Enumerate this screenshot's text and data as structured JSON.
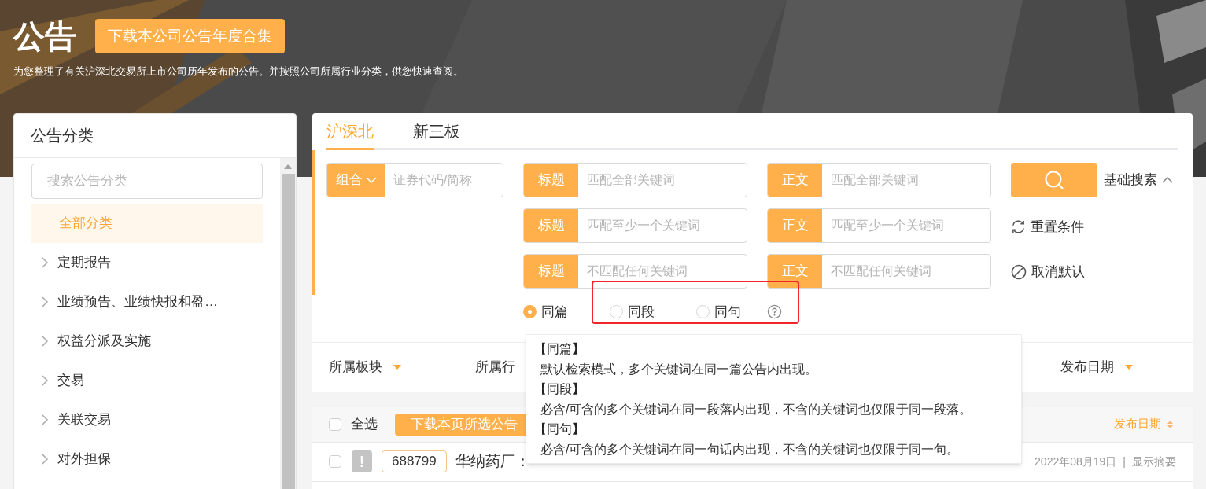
{
  "header": {
    "title": "公告",
    "download_button": "下载本公司公告年度合集",
    "description": "为您整理了有关沪深北交易所上市公司历年发布的公告。并按照公司所属行业分类，供您快速查阅。"
  },
  "sidebar": {
    "title": "公告分类",
    "search": {
      "placeholder": "搜索公告分类"
    },
    "items": [
      {
        "label": "全部分类",
        "selected": true,
        "expandable": false
      },
      {
        "label": "定期报告",
        "selected": false,
        "expandable": true
      },
      {
        "label": "业绩预告、业绩快报和盈…",
        "selected": false,
        "expandable": true
      },
      {
        "label": "权益分派及实施",
        "selected": false,
        "expandable": true
      },
      {
        "label": "交易",
        "selected": false,
        "expandable": true
      },
      {
        "label": "关联交易",
        "selected": false,
        "expandable": true
      },
      {
        "label": "对外担保",
        "selected": false,
        "expandable": true
      }
    ]
  },
  "tabs": [
    {
      "label": "沪深北",
      "selected": true
    },
    {
      "label": "新三板",
      "selected": false
    }
  ],
  "search": {
    "combo": {
      "label": "组合",
      "placeholder": "证券代码/简称"
    },
    "title_fields": [
      {
        "tag": "标题",
        "placeholder": "匹配全部关键词"
      },
      {
        "tag": "标题",
        "placeholder": "匹配至少一个关键词"
      },
      {
        "tag": "标题",
        "placeholder": "不匹配任何关键词"
      }
    ],
    "body_fields": [
      {
        "tag": "正文",
        "placeholder": "匹配全部关键词"
      },
      {
        "tag": "正文",
        "placeholder": "匹配至少一个关键词"
      },
      {
        "tag": "正文",
        "placeholder": "不匹配任何关键词"
      }
    ],
    "mode_toggle": "基础搜索",
    "reset": "重置条件",
    "cancel_default": "取消默认",
    "match_modes": [
      {
        "label": "同篇",
        "selected": true
      },
      {
        "label": "同段",
        "selected": false
      },
      {
        "label": "同句",
        "selected": false
      }
    ]
  },
  "filters": [
    {
      "label": "所属板块",
      "kind": "dropdown"
    },
    {
      "label": "所属行",
      "kind": "covered"
    },
    {
      "label": "发布日期",
      "kind": "dropdown"
    }
  ],
  "list": {
    "select_all": {
      "label": "全选",
      "checked": false
    },
    "download_button": "下载本页所选公告",
    "sort_label": "发布日期",
    "rows": [
      {
        "checked": false,
        "flag": "!",
        "code": "688799",
        "title": "华纳药厂：",
        "date": "2022年08月19日",
        "separator": "|",
        "action": "显示摘要"
      }
    ]
  },
  "tooltip": {
    "lines": [
      {
        "kind": "heading",
        "text": "【同篇】"
      },
      {
        "kind": "body",
        "text": "默认检索模式，多个关键词在同一篇公告内出现。"
      },
      {
        "kind": "heading",
        "text": "【同段】"
      },
      {
        "kind": "body",
        "text": "必含/可含的多个关键词在同一段落内出现，不含的关键词也仅限于同一段落。"
      },
      {
        "kind": "heading",
        "text": "【同句】"
      },
      {
        "kind": "body",
        "text": "必含/可含的多个关键词在同一句话内出现，不含的关键词也仅限于同一句。"
      }
    ]
  }
}
